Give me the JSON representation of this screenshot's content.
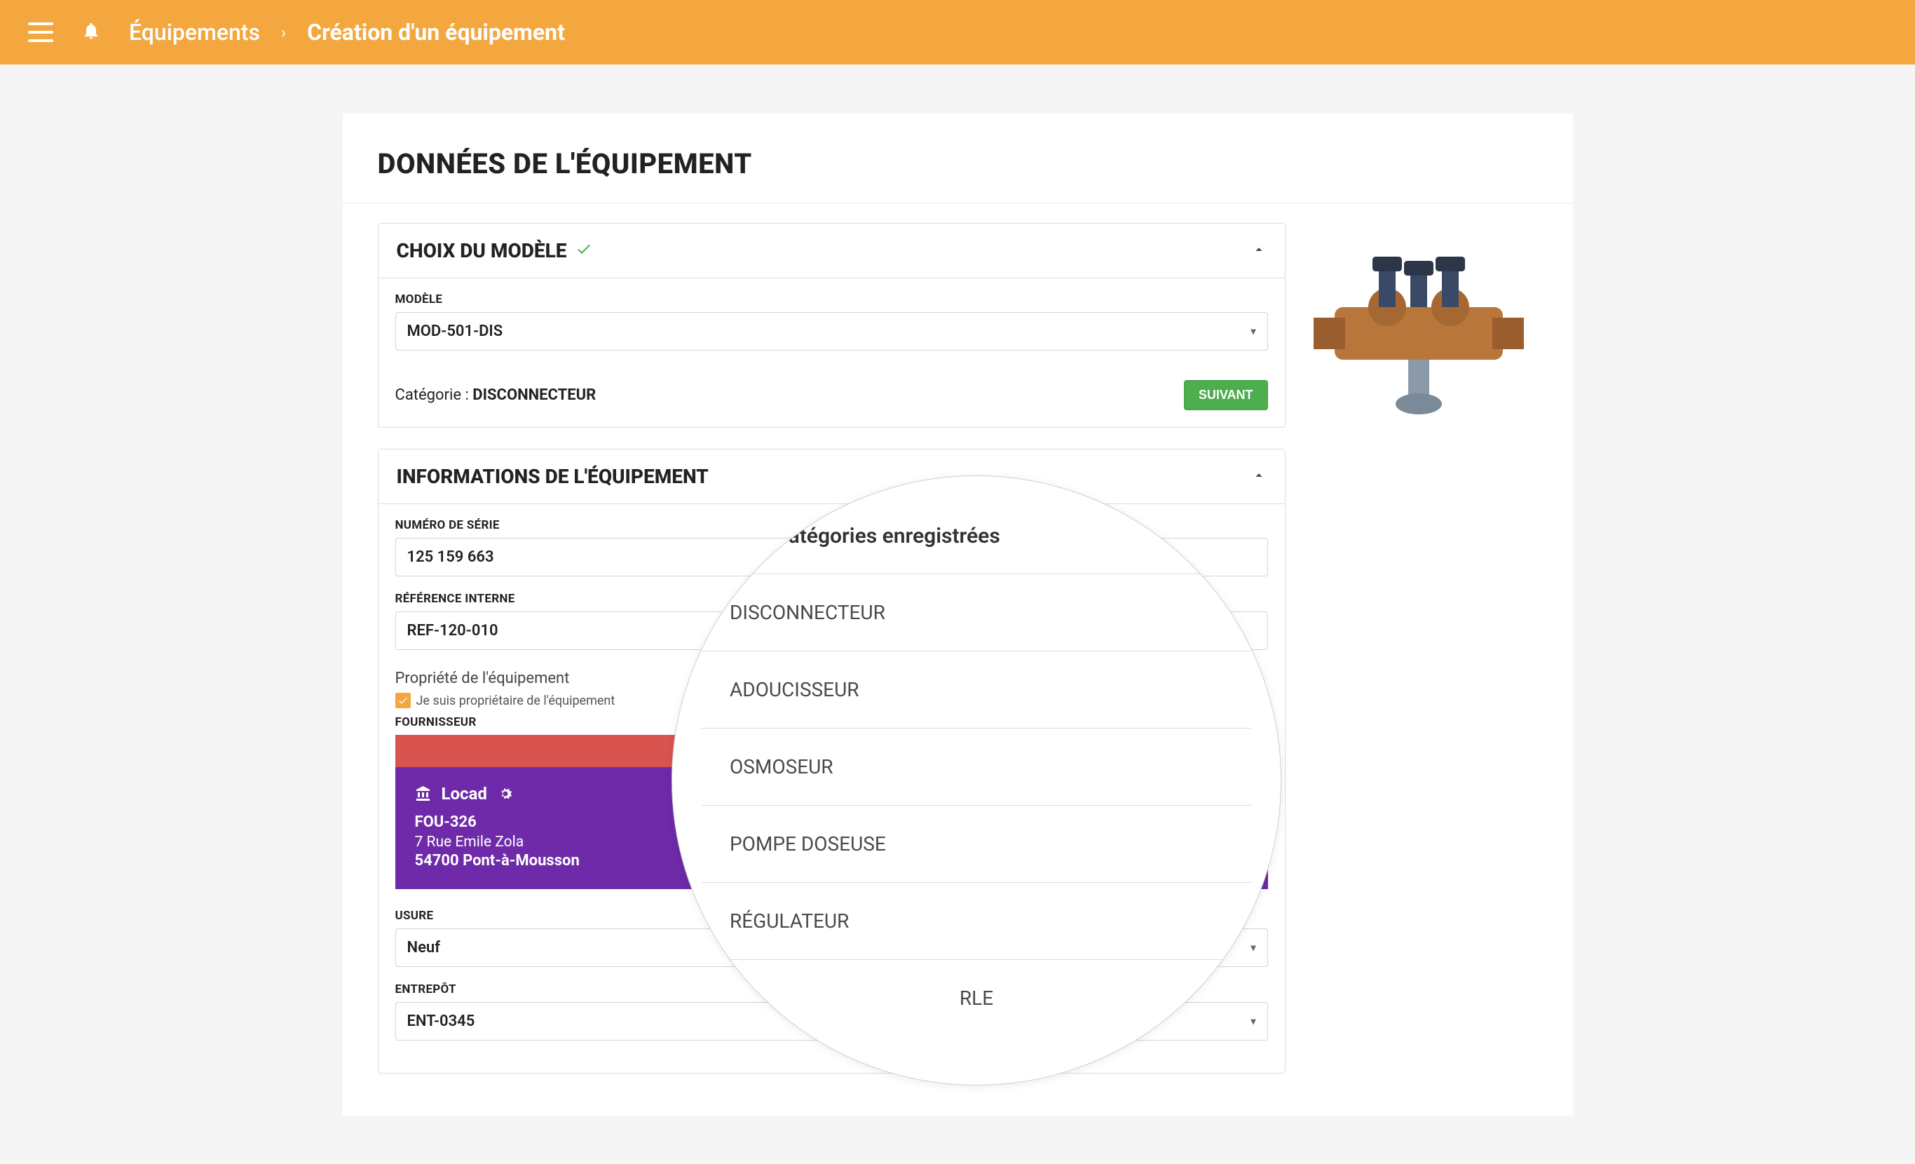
{
  "header": {
    "breadcrumb_root": "Équipements",
    "breadcrumb_current": "Création d'un équipement"
  },
  "page": {
    "title": "DONNÉES DE L'ÉQUIPEMENT"
  },
  "panel_model": {
    "title": "CHOIX DU MODÈLE",
    "field_label": "MODÈLE",
    "model_value": "MOD-501-DIS",
    "category_label": "Catégorie :",
    "category_value": "DISCONNECTEUR",
    "btn_next": "SUIVANT"
  },
  "panel_info": {
    "title": "INFORMATIONS DE L'ÉQUIPEMENT",
    "serial_label": "NUMÉRO DE SÉRIE",
    "serial_value": "125 159 663",
    "ref_label": "RÉFÉRENCE INTERNE",
    "ref_value": "REF-120-010",
    "ownership_title": "Propriété de l'équipement",
    "ownership_checkbox": "Je suis propriétaire de l'équipement",
    "fournisseur_label": "FOURNISSEUR",
    "supplier": {
      "name": "Locad",
      "ref": "FOU-326",
      "address": "7 Rue Emile Zola",
      "city": "54700 Pont-à-Mousson"
    },
    "usure_label": "USURE",
    "usure_value": "Neuf",
    "entrepot_label": "ENTREPÔT",
    "entrepot_value": "ENT-0345"
  },
  "bubble": {
    "title": "Catégories enregistrées",
    "items": [
      "DISCONNECTEUR",
      "ADOUCISSEUR",
      "OSMOSEUR",
      "POMPE DOSEUSE",
      "RÉGULATEUR",
      "RLE"
    ]
  },
  "colors": {
    "accent": "#f4a73f",
    "success": "#4cae4c",
    "danger": "#d9534f",
    "purple": "#6e2aa8"
  }
}
